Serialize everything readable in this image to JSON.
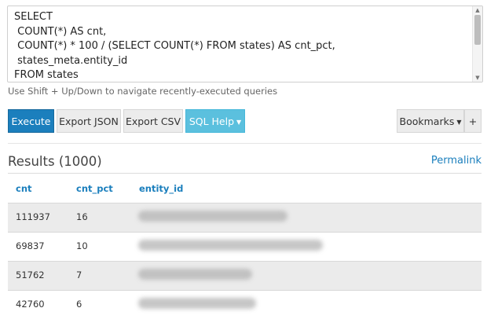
{
  "editor": {
    "lines": [
      "SELECT",
      " COUNT(*) AS cnt,",
      " COUNT(*) * 100 / (SELECT COUNT(*) FROM states) AS cnt_pct,",
      " states_meta.entity_id",
      "FROM states"
    ]
  },
  "hint": "Use Shift + Up/Down to navigate recently-executed queries",
  "toolbar": {
    "execute_label": "Execute",
    "export_json_label": "Export JSON",
    "export_csv_label": "Export CSV",
    "sql_help_label": "SQL Help",
    "bookmarks_label": "Bookmarks",
    "plus_label": "+"
  },
  "results": {
    "title": "Results (1000)",
    "permalink_label": "Permalink",
    "columns": [
      "cnt",
      "cnt_pct",
      "entity_id"
    ],
    "rows": [
      {
        "cnt": "111937",
        "cnt_pct": "16"
      },
      {
        "cnt": "69837",
        "cnt_pct": "10"
      },
      {
        "cnt": "51762",
        "cnt_pct": "7"
      },
      {
        "cnt": "42760",
        "cnt_pct": "6"
      }
    ]
  },
  "icons": {
    "dropdown": "caret-down-icon",
    "scroll_up": "scroll-up-arrow-icon",
    "scroll_down": "scroll-down-arrow-icon"
  },
  "colors": {
    "primary": "#1b7fbd",
    "info": "#5bc0de",
    "stripe": "#ebebeb"
  }
}
